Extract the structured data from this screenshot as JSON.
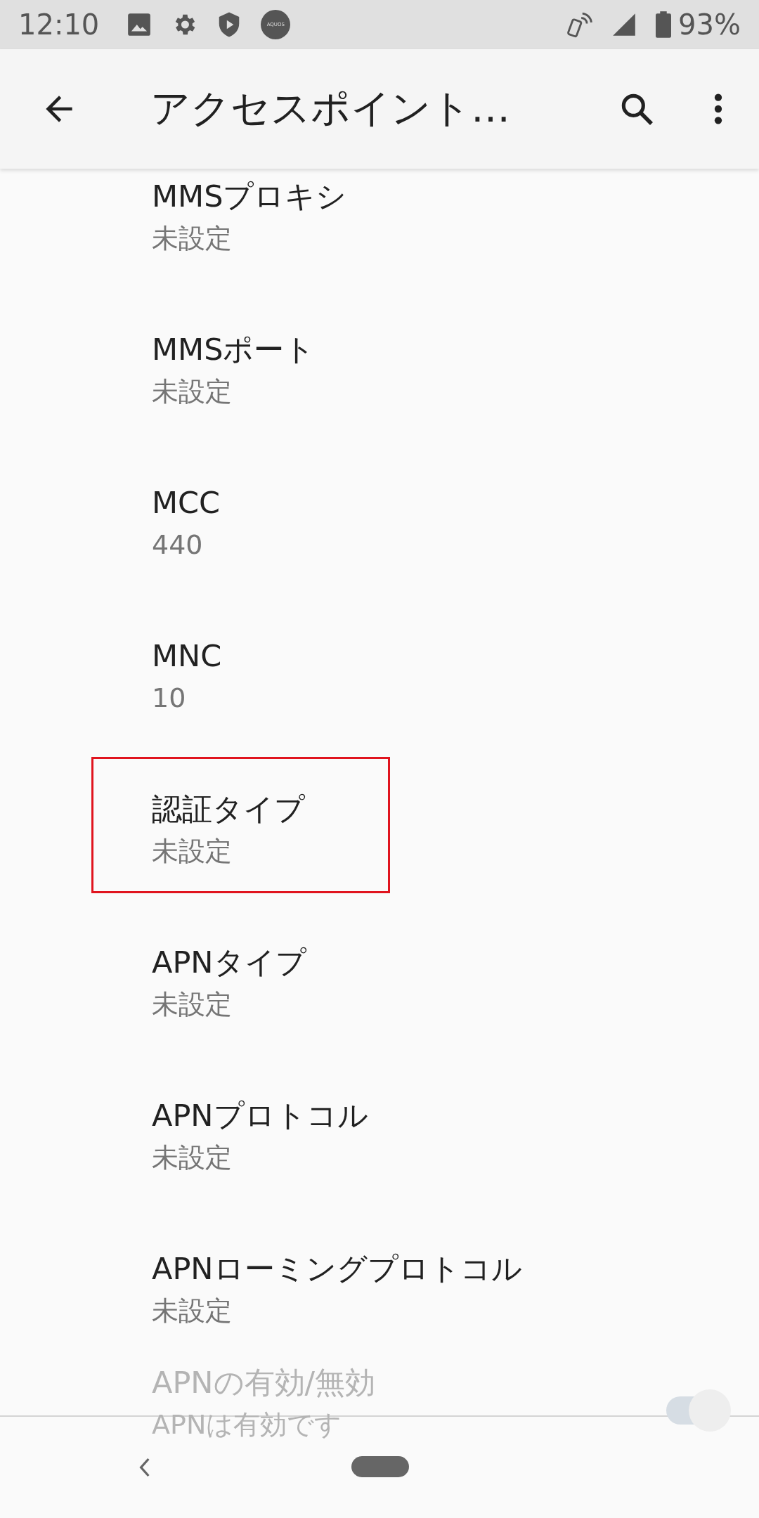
{
  "status_bar": {
    "time": "12:10",
    "badge": "AQUOS",
    "battery": "93%"
  },
  "app_bar": {
    "title": "アクセスポイント…"
  },
  "items": [
    {
      "title": "MMSプロキシ",
      "summary": "未設定",
      "highlighted": false
    },
    {
      "title": "MMSポート",
      "summary": "未設定",
      "highlighted": false
    },
    {
      "title": "MCC",
      "summary": "440",
      "highlighted": false
    },
    {
      "title": "MNC",
      "summary": "10",
      "highlighted": false
    },
    {
      "title": "認証タイプ",
      "summary": "未設定",
      "highlighted": true
    },
    {
      "title": "APNタイプ",
      "summary": "未設定",
      "highlighted": false
    },
    {
      "title": "APNプロトコル",
      "summary": "未設定",
      "highlighted": false
    },
    {
      "title": "APNローミングプロトコル",
      "summary": "未設定",
      "highlighted": false
    }
  ],
  "toggle_item": {
    "title": "APNの有効/無効",
    "summary": "APNは有効です",
    "on": true
  }
}
